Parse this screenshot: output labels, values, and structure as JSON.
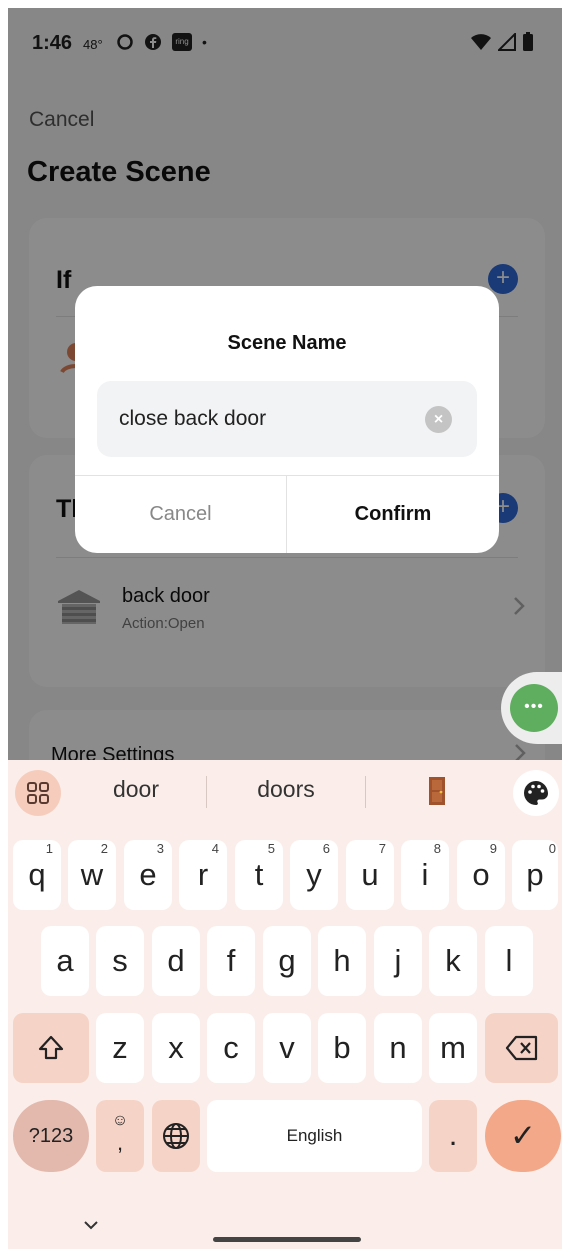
{
  "status_bar": {
    "time": "1:46",
    "temperature": "48°",
    "icons": [
      "circle-o-icon",
      "facebook-icon",
      "ring-icon",
      "dot-icon"
    ],
    "ring_label": "ring",
    "dot": "•",
    "right_icons": [
      "wifi-icon",
      "signal-icon",
      "battery-icon"
    ]
  },
  "page": {
    "cancel_label": "Cancel",
    "title": "Create Scene",
    "if_label": "If",
    "then_label": "Then",
    "device": {
      "name": "back door",
      "action": "Action:Open"
    },
    "more_settings_label": "More Settings",
    "fab_icon": "ellipsis-icon",
    "fab_dots": "•••"
  },
  "dialog": {
    "title": "Scene Name",
    "input_value": "close back door",
    "clear_icon": "×",
    "cancel_label": "Cancel",
    "confirm_label": "Confirm"
  },
  "keyboard": {
    "suggestions": [
      "door",
      "doors"
    ],
    "suggestion_emoji": "door-emoji-icon",
    "row1": [
      {
        "key": "q",
        "num": "1"
      },
      {
        "key": "w",
        "num": "2"
      },
      {
        "key": "e",
        "num": "3"
      },
      {
        "key": "r",
        "num": "4"
      },
      {
        "key": "t",
        "num": "5"
      },
      {
        "key": "y",
        "num": "6"
      },
      {
        "key": "u",
        "num": "7"
      },
      {
        "key": "i",
        "num": "8"
      },
      {
        "key": "o",
        "num": "9"
      },
      {
        "key": "p",
        "num": "0"
      }
    ],
    "row2": [
      "a",
      "s",
      "d",
      "f",
      "g",
      "h",
      "j",
      "k",
      "l"
    ],
    "row3": [
      "z",
      "x",
      "c",
      "v",
      "b",
      "n",
      "m"
    ],
    "symbols_label": "?123",
    "emoji_comma_emoji": "☺",
    "emoji_comma_char": ",",
    "space_label": "English",
    "period_label": ".",
    "enter_icon": "check-icon",
    "check_glyph": "✓",
    "accent_color": "#f2a889"
  }
}
